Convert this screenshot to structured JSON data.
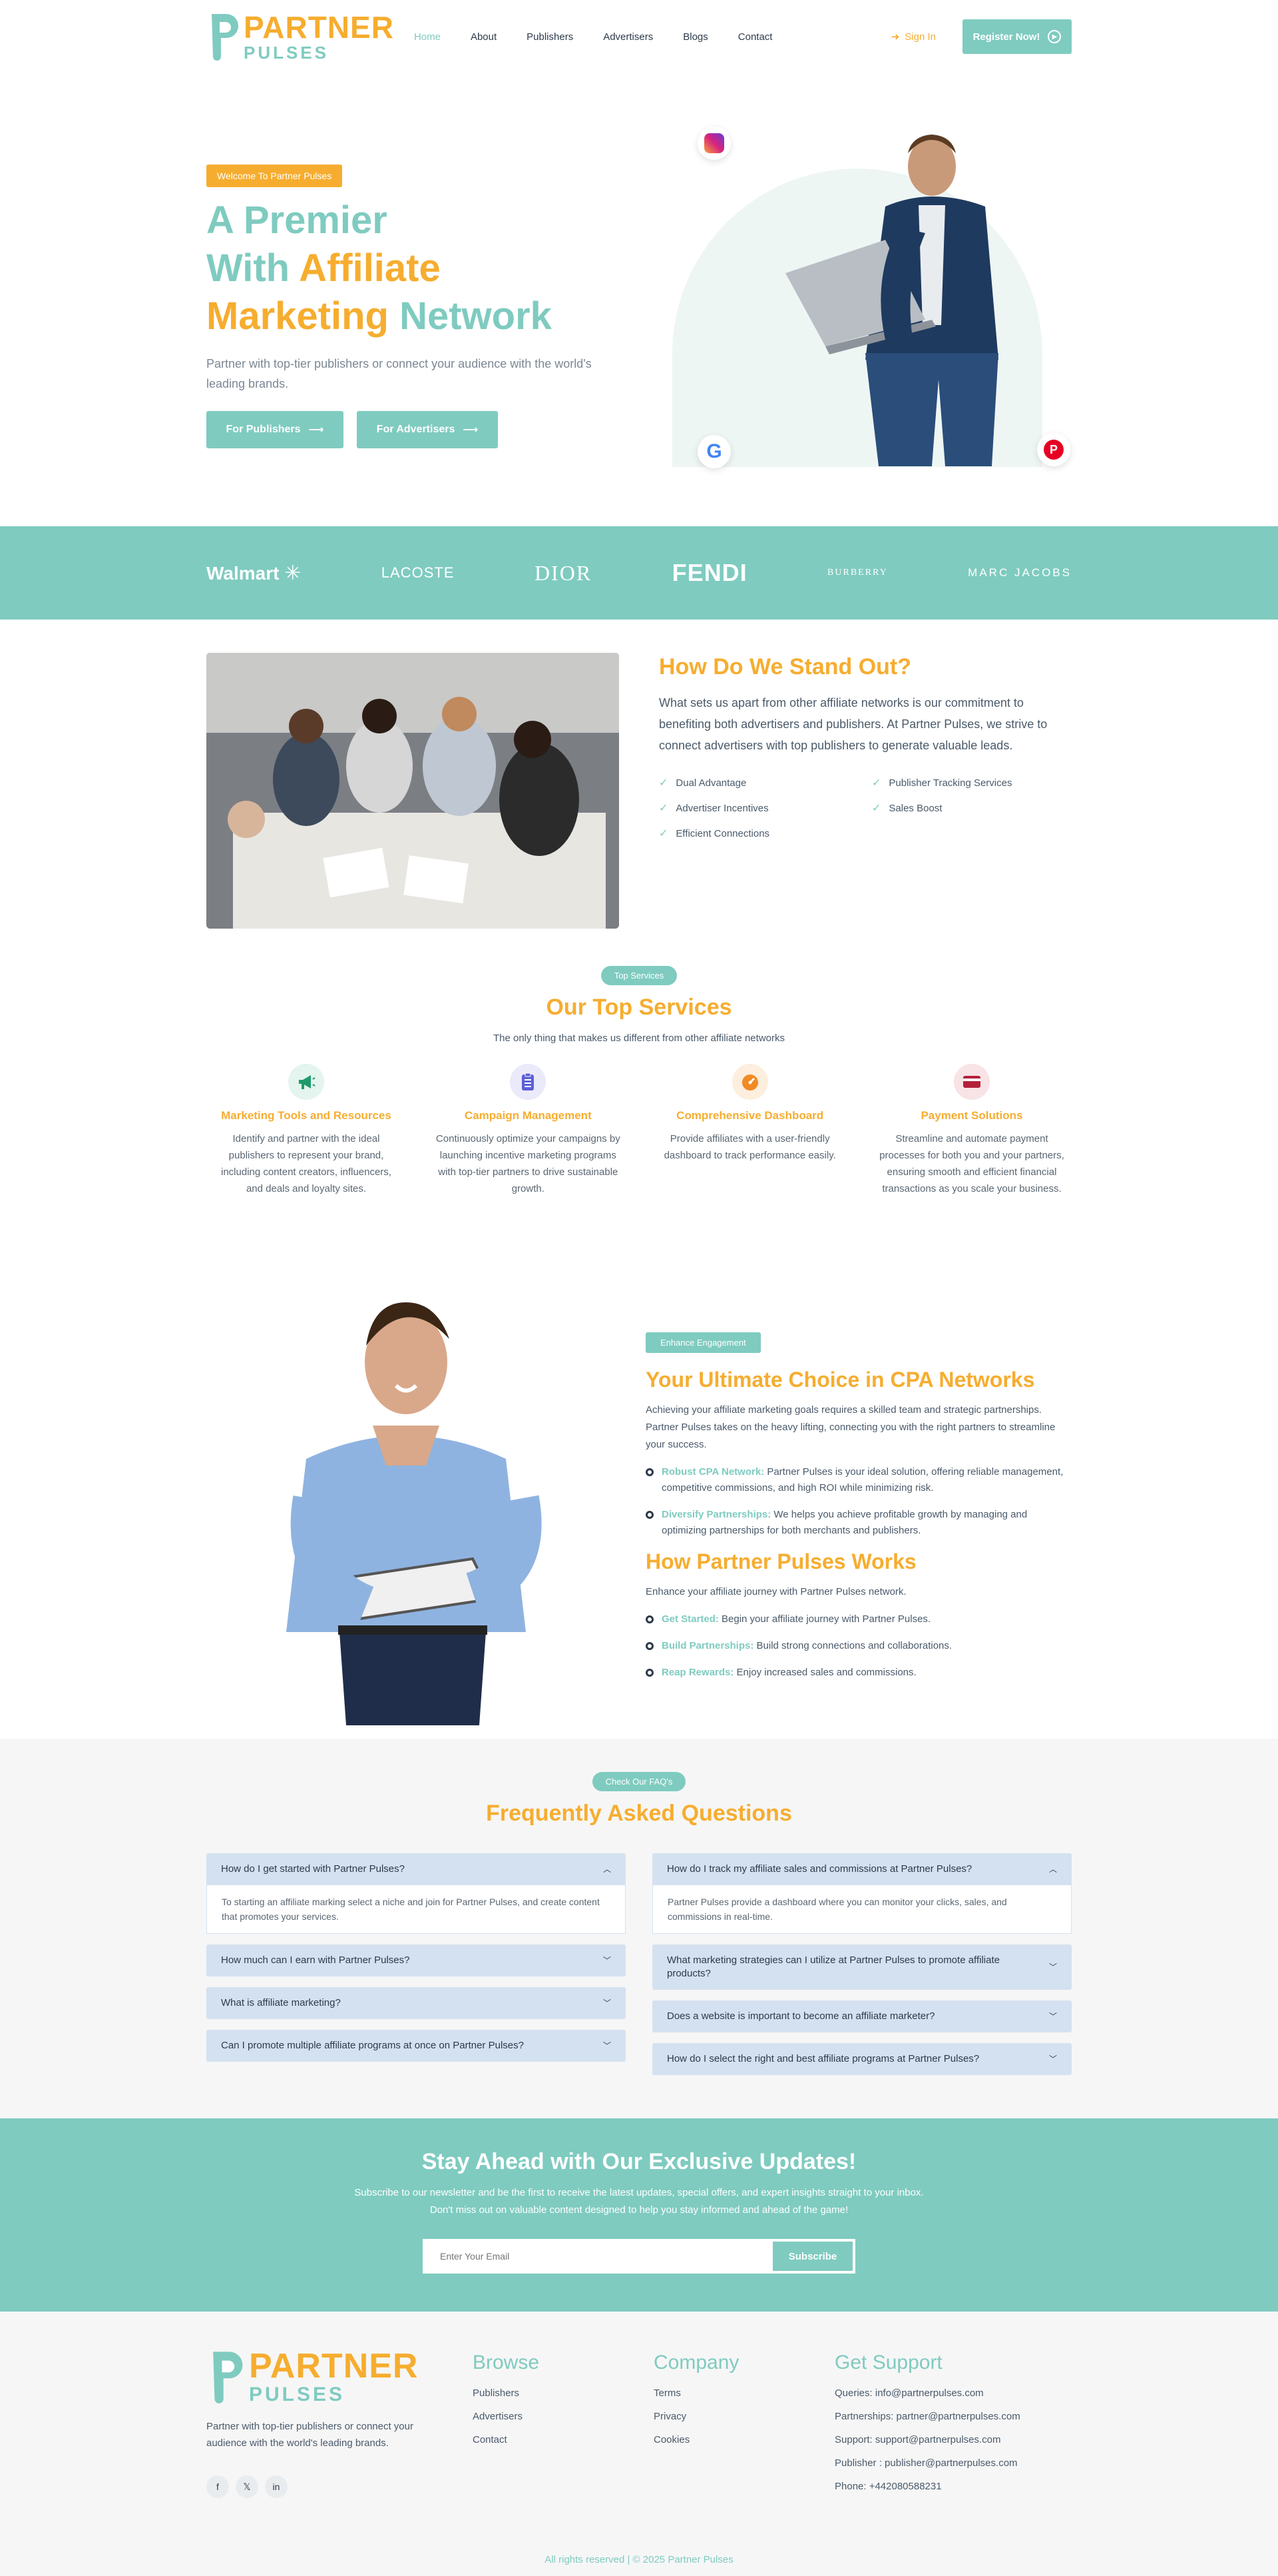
{
  "brand": {
    "name_top": "PARTNER",
    "name_bottom": "PULSES"
  },
  "nav": {
    "items": [
      {
        "label": "Home",
        "active": true
      },
      {
        "label": "About"
      },
      {
        "label": "Publishers"
      },
      {
        "label": "Advertisers"
      },
      {
        "label": "Blogs"
      },
      {
        "label": "Contact"
      }
    ],
    "signin": "Sign In",
    "register": "Register Now!"
  },
  "hero": {
    "badge": "Welcome To Partner Pulses",
    "title_1": "A Premier",
    "title_2a": "With ",
    "title_2b": "Affiliate",
    "title_3a": "Marketing ",
    "title_3b": "Network",
    "text": "Partner with top-tier publishers or connect your audience with the world's leading brands.",
    "btn_publishers": "For Publishers",
    "btn_advertisers": "For Advertisers"
  },
  "brands": [
    "Walmart",
    "LACOSTE",
    "DIOR",
    "FENDI",
    "BURBERRY",
    "MARC JACOBS"
  ],
  "standout": {
    "title": "How Do We Stand Out?",
    "text": "What sets us apart from other affiliate networks is our commitment to benefiting both advertisers and publishers. At Partner Pulses, we strive to connect advertisers with top publishers to generate valuable leads.",
    "checks": [
      "Dual Advantage",
      "Publisher Tracking Services",
      "Advertiser Incentives",
      "Sales Boost",
      "Efficient Connections"
    ]
  },
  "services": {
    "badge": "Top Services",
    "title": "Our Top Services",
    "subtitle": "The only thing that makes us different from other affiliate networks",
    "items": [
      {
        "title": "Marketing Tools and Resources",
        "text": "Identify and partner with the ideal publishers to represent your brand, including content creators, influencers, and deals and loyalty sites.",
        "color": "#1e9b6c"
      },
      {
        "title": "Campaign Management",
        "text": "Continuously optimize your campaigns by launching incentive marketing programs with top-tier partners to drive sustainable growth.",
        "color": "#5d5fd6"
      },
      {
        "title": "Comprehensive Dashboard",
        "text": "Provide affiliates with a user-friendly dashboard to track performance easily.",
        "color": "#f08a24"
      },
      {
        "title": "Payment Solutions",
        "text": "Streamline and automate payment processes for both you and your partners, ensuring smooth and efficient financial transactions as you scale your business.",
        "color": "#b3203a"
      }
    ]
  },
  "cpa": {
    "badge": "Enhance Engagement",
    "title": "Your Ultimate Choice in CPA Networks",
    "text": "Achieving your affiliate marketing goals requires a skilled team and strategic partnerships. Partner Pulses takes on the heavy lifting, connecting you with the right partners to streamline your success.",
    "points": [
      {
        "label": "Robust CPA Network:",
        "text": " Partner Pulses is your ideal solution, offering reliable management, competitive commissions, and high ROI while minimizing risk."
      },
      {
        "label": "Diversify Partnerships:",
        "text": " We helps you achieve profitable growth by managing and optimizing partnerships for both merchants and publishers."
      }
    ],
    "works_title": "How Partner Pulses Works",
    "works_text": "Enhance your affiliate journey with Partner Pulses network.",
    "steps": [
      {
        "label": "Get Started:",
        "text": " Begin your affiliate journey with Partner Pulses."
      },
      {
        "label": "Build Partnerships:",
        "text": " Build strong connections and collaborations."
      },
      {
        "label": "Reap Rewards:",
        "text": " Enjoy increased sales and commissions."
      }
    ]
  },
  "faq": {
    "badge": "Check Our FAQ's",
    "title": "Frequently Asked Questions",
    "left": [
      {
        "q": "How do I get started with Partner Pulses?",
        "a": "To starting an affiliate marking select a niche and join for Partner Pulses, and create content that promotes your services.",
        "open": true
      },
      {
        "q": "How much can I earn with Partner Pulses?"
      },
      {
        "q": "What is affiliate marketing?"
      },
      {
        "q": "Can I promote multiple affiliate programs at once on Partner Pulses?"
      }
    ],
    "right": [
      {
        "q": "How do I track my affiliate sales and commissions at Partner Pulses?",
        "a": "Partner Pulses provide a dashboard where you can monitor your clicks, sales, and commissions in real-time.",
        "open": true
      },
      {
        "q": "What marketing strategies can I utilize at Partner Pulses to promote affiliate products?"
      },
      {
        "q": "Does a website is important to become an affiliate marketer?"
      },
      {
        "q": "How do I select the right and best affiliate programs at Partner Pulses?"
      }
    ]
  },
  "newsletter": {
    "title": "Stay Ahead with Our Exclusive Updates!",
    "text_1": "Subscribe to our newsletter and be the first to receive the latest updates, special offers, and expert insights straight to your inbox.",
    "text_2": "Don't miss out on valuable content designed to help you stay informed and ahead of the game!",
    "placeholder": "Enter Your Email",
    "button": "Subscribe"
  },
  "footer": {
    "desc": "Partner with top-tier publishers or connect your audience with the world's leading brands.",
    "browse_title": "Browse",
    "browse": [
      "Publishers",
      "Advertisers",
      "Contact"
    ],
    "company_title": "Company",
    "company": [
      "Terms",
      "Privacy",
      "Cookies"
    ],
    "support_title": "Get Support",
    "support": [
      "Queries: info@partnerpulses.com",
      "Partnerships: partner@partnerpulses.com",
      "Support: support@partnerpulses.com",
      "Publisher : publisher@partnerpulses.com",
      "Phone: +442080588231"
    ],
    "copyright": "All rights reserved | © 2025 Partner Pulses"
  }
}
